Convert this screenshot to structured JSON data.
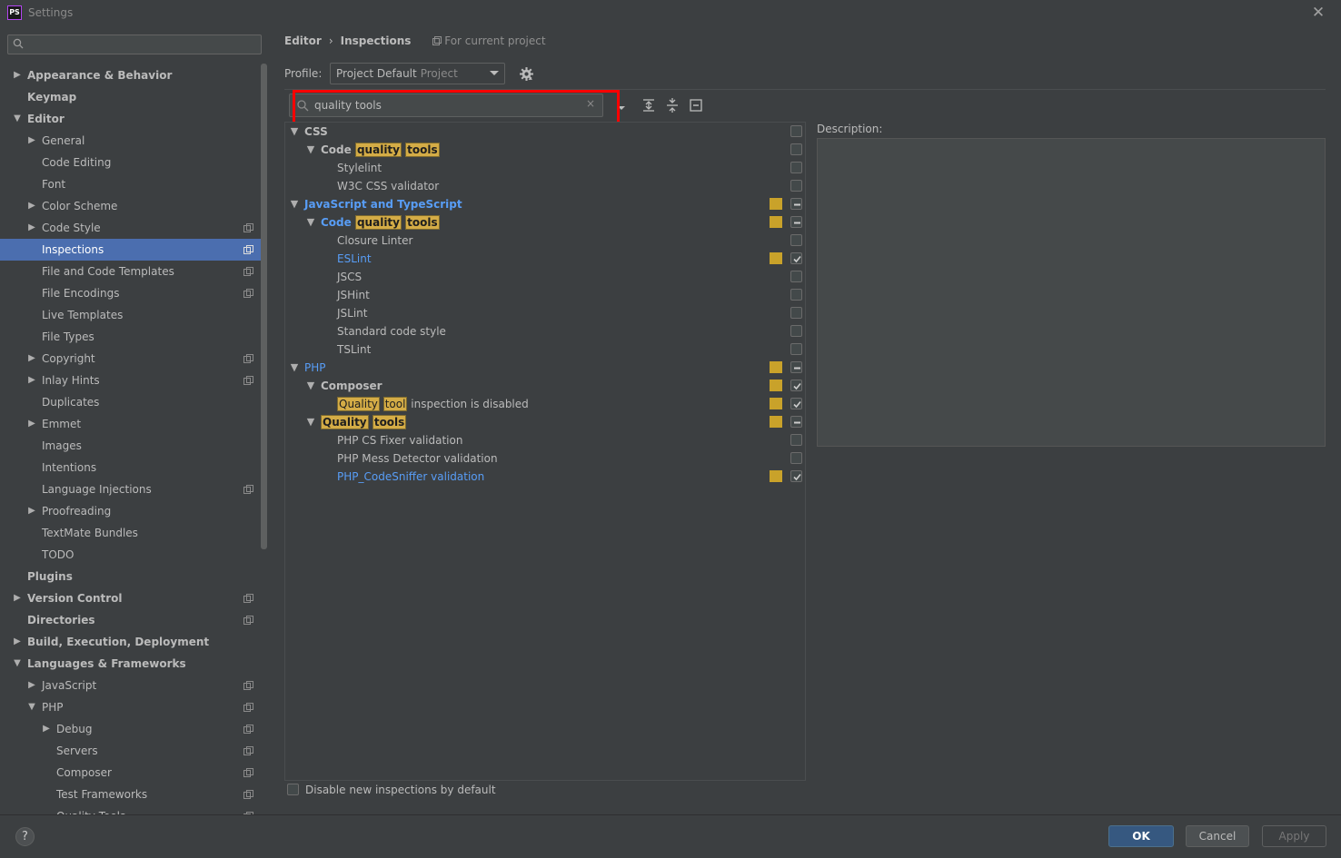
{
  "window": {
    "title": "Settings",
    "app_icon": "PS"
  },
  "search": {
    "placeholder": "",
    "value": ""
  },
  "sidebar": {
    "items": [
      {
        "label": "Appearance & Behavior",
        "level": 0,
        "arrow": "right",
        "bold": true,
        "project": false,
        "selected": false
      },
      {
        "label": "Keymap",
        "level": 0,
        "arrow": "",
        "bold": true,
        "project": false,
        "selected": false
      },
      {
        "label": "Editor",
        "level": 0,
        "arrow": "down",
        "bold": true,
        "project": false,
        "selected": false
      },
      {
        "label": "General",
        "level": 1,
        "arrow": "right",
        "bold": false,
        "project": false,
        "selected": false
      },
      {
        "label": "Code Editing",
        "level": 1,
        "arrow": "",
        "bold": false,
        "project": false,
        "selected": false
      },
      {
        "label": "Font",
        "level": 1,
        "arrow": "",
        "bold": false,
        "project": false,
        "selected": false
      },
      {
        "label": "Color Scheme",
        "level": 1,
        "arrow": "right",
        "bold": false,
        "project": false,
        "selected": false
      },
      {
        "label": "Code Style",
        "level": 1,
        "arrow": "right",
        "bold": false,
        "project": true,
        "selected": false
      },
      {
        "label": "Inspections",
        "level": 1,
        "arrow": "",
        "bold": false,
        "project": true,
        "selected": true
      },
      {
        "label": "File and Code Templates",
        "level": 1,
        "arrow": "",
        "bold": false,
        "project": true,
        "selected": false
      },
      {
        "label": "File Encodings",
        "level": 1,
        "arrow": "",
        "bold": false,
        "project": true,
        "selected": false
      },
      {
        "label": "Live Templates",
        "level": 1,
        "arrow": "",
        "bold": false,
        "project": false,
        "selected": false
      },
      {
        "label": "File Types",
        "level": 1,
        "arrow": "",
        "bold": false,
        "project": false,
        "selected": false
      },
      {
        "label": "Copyright",
        "level": 1,
        "arrow": "right",
        "bold": false,
        "project": true,
        "selected": false
      },
      {
        "label": "Inlay Hints",
        "level": 1,
        "arrow": "right",
        "bold": false,
        "project": true,
        "selected": false
      },
      {
        "label": "Duplicates",
        "level": 1,
        "arrow": "",
        "bold": false,
        "project": false,
        "selected": false
      },
      {
        "label": "Emmet",
        "level": 1,
        "arrow": "right",
        "bold": false,
        "project": false,
        "selected": false
      },
      {
        "label": "Images",
        "level": 1,
        "arrow": "",
        "bold": false,
        "project": false,
        "selected": false
      },
      {
        "label": "Intentions",
        "level": 1,
        "arrow": "",
        "bold": false,
        "project": false,
        "selected": false
      },
      {
        "label": "Language Injections",
        "level": 1,
        "arrow": "",
        "bold": false,
        "project": true,
        "selected": false
      },
      {
        "label": "Proofreading",
        "level": 1,
        "arrow": "right",
        "bold": false,
        "project": false,
        "selected": false
      },
      {
        "label": "TextMate Bundles",
        "level": 1,
        "arrow": "",
        "bold": false,
        "project": false,
        "selected": false
      },
      {
        "label": "TODO",
        "level": 1,
        "arrow": "",
        "bold": false,
        "project": false,
        "selected": false
      },
      {
        "label": "Plugins",
        "level": 0,
        "arrow": "",
        "bold": true,
        "project": false,
        "selected": false
      },
      {
        "label": "Version Control",
        "level": 0,
        "arrow": "right",
        "bold": true,
        "project": true,
        "selected": false
      },
      {
        "label": "Directories",
        "level": 0,
        "arrow": "",
        "bold": true,
        "project": true,
        "selected": false
      },
      {
        "label": "Build, Execution, Deployment",
        "level": 0,
        "arrow": "right",
        "bold": true,
        "project": false,
        "selected": false
      },
      {
        "label": "Languages & Frameworks",
        "level": 0,
        "arrow": "down",
        "bold": true,
        "project": false,
        "selected": false
      },
      {
        "label": "JavaScript",
        "level": 1,
        "arrow": "right",
        "bold": false,
        "project": true,
        "selected": false
      },
      {
        "label": "PHP",
        "level": 1,
        "arrow": "down",
        "bold": false,
        "project": true,
        "selected": false
      },
      {
        "label": "Debug",
        "level": 2,
        "arrow": "right",
        "bold": false,
        "project": true,
        "selected": false
      },
      {
        "label": "Servers",
        "level": 2,
        "arrow": "",
        "bold": false,
        "project": true,
        "selected": false
      },
      {
        "label": "Composer",
        "level": 2,
        "arrow": "",
        "bold": false,
        "project": true,
        "selected": false
      },
      {
        "label": "Test Frameworks",
        "level": 2,
        "arrow": "",
        "bold": false,
        "project": true,
        "selected": false
      },
      {
        "label": "Quality Tools",
        "level": 2,
        "arrow": "",
        "bold": false,
        "project": true,
        "selected": false
      }
    ]
  },
  "breadcrumb": {
    "parent": "Editor",
    "separator": "›",
    "current": "Inspections",
    "scope": "For current project"
  },
  "profile": {
    "label": "Profile:",
    "value": "Project Default",
    "sub": "Project"
  },
  "filter": {
    "value": "quality tools",
    "clear": "×"
  },
  "inspections": [
    {
      "parts": [
        {
          "t": "CSS",
          "h": false
        }
      ],
      "level": 0,
      "arrow": "down",
      "bold": true,
      "blue": false,
      "severity": false,
      "check": "off"
    },
    {
      "parts": [
        {
          "t": "Code ",
          "h": false
        },
        {
          "t": "quality",
          "h": true
        },
        {
          "t": " ",
          "h": false
        },
        {
          "t": "tools",
          "h": true
        }
      ],
      "level": 1,
      "arrow": "down",
      "bold": true,
      "blue": false,
      "severity": false,
      "check": "off"
    },
    {
      "parts": [
        {
          "t": "Stylelint",
          "h": false
        }
      ],
      "level": 2,
      "arrow": "",
      "bold": false,
      "blue": false,
      "severity": false,
      "check": "off"
    },
    {
      "parts": [
        {
          "t": "W3C CSS validator",
          "h": false
        }
      ],
      "level": 2,
      "arrow": "",
      "bold": false,
      "blue": false,
      "severity": false,
      "check": "off"
    },
    {
      "parts": [
        {
          "t": "JavaScript and TypeScript",
          "h": false
        }
      ],
      "level": 0,
      "arrow": "down",
      "bold": true,
      "blue": true,
      "severity": true,
      "check": "partial"
    },
    {
      "parts": [
        {
          "t": "Code ",
          "h": false
        },
        {
          "t": "quality",
          "h": true
        },
        {
          "t": " ",
          "h": false
        },
        {
          "t": "tools",
          "h": true
        }
      ],
      "level": 1,
      "arrow": "down",
      "bold": true,
      "blue": true,
      "severity": true,
      "check": "partial"
    },
    {
      "parts": [
        {
          "t": "Closure Linter",
          "h": false
        }
      ],
      "level": 2,
      "arrow": "",
      "bold": false,
      "blue": false,
      "severity": false,
      "check": "off"
    },
    {
      "parts": [
        {
          "t": "ESLint",
          "h": false
        }
      ],
      "level": 2,
      "arrow": "",
      "bold": false,
      "blue": true,
      "severity": true,
      "check": "on"
    },
    {
      "parts": [
        {
          "t": "JSCS",
          "h": false
        }
      ],
      "level": 2,
      "arrow": "",
      "bold": false,
      "blue": false,
      "severity": false,
      "check": "off"
    },
    {
      "parts": [
        {
          "t": "JSHint",
          "h": false
        }
      ],
      "level": 2,
      "arrow": "",
      "bold": false,
      "blue": false,
      "severity": false,
      "check": "off"
    },
    {
      "parts": [
        {
          "t": "JSLint",
          "h": false
        }
      ],
      "level": 2,
      "arrow": "",
      "bold": false,
      "blue": false,
      "severity": false,
      "check": "off"
    },
    {
      "parts": [
        {
          "t": "Standard code style",
          "h": false
        }
      ],
      "level": 2,
      "arrow": "",
      "bold": false,
      "blue": false,
      "severity": false,
      "check": "off"
    },
    {
      "parts": [
        {
          "t": "TSLint",
          "h": false
        }
      ],
      "level": 2,
      "arrow": "",
      "bold": false,
      "blue": false,
      "severity": false,
      "check": "off"
    },
    {
      "parts": [
        {
          "t": "PHP",
          "h": false
        }
      ],
      "level": 0,
      "arrow": "down",
      "bold": false,
      "blue": true,
      "severity": true,
      "check": "partial"
    },
    {
      "parts": [
        {
          "t": "Composer",
          "h": false
        }
      ],
      "level": 1,
      "arrow": "down",
      "bold": true,
      "blue": false,
      "severity": true,
      "check": "on"
    },
    {
      "parts": [
        {
          "t": "Quality",
          "h": true
        },
        {
          "t": " ",
          "h": false
        },
        {
          "t": "tool",
          "h": true
        },
        {
          "t": " inspection is disabled",
          "h": false
        }
      ],
      "level": 2,
      "arrow": "",
      "bold": false,
      "blue": false,
      "severity": true,
      "check": "on"
    },
    {
      "parts": [
        {
          "t": "Quality",
          "h": true
        },
        {
          "t": " ",
          "h": false
        },
        {
          "t": "tools",
          "h": true
        }
      ],
      "level": 1,
      "arrow": "down",
      "bold": true,
      "blue": false,
      "severity": true,
      "check": "partial"
    },
    {
      "parts": [
        {
          "t": "PHP CS Fixer validation",
          "h": false
        }
      ],
      "level": 2,
      "arrow": "",
      "bold": false,
      "blue": false,
      "severity": false,
      "check": "off"
    },
    {
      "parts": [
        {
          "t": "PHP Mess Detector validation",
          "h": false
        }
      ],
      "level": 2,
      "arrow": "",
      "bold": false,
      "blue": false,
      "severity": false,
      "check": "off"
    },
    {
      "parts": [
        {
          "t": "PHP_CodeSniffer validation",
          "h": false
        }
      ],
      "level": 2,
      "arrow": "",
      "bold": false,
      "blue": true,
      "severity": true,
      "check": "on"
    }
  ],
  "description": {
    "label": "Description:"
  },
  "footer": {
    "disable_label": "Disable new inspections by default",
    "help": "?",
    "ok": "OK",
    "cancel": "Cancel",
    "apply": "Apply"
  },
  "colors": {
    "selection": "#4b6eaf",
    "severity_warning": "#c9a22a",
    "highlight": "#d4ac46",
    "link_blue": "#589df6",
    "annotation_red": "#ff0000"
  }
}
